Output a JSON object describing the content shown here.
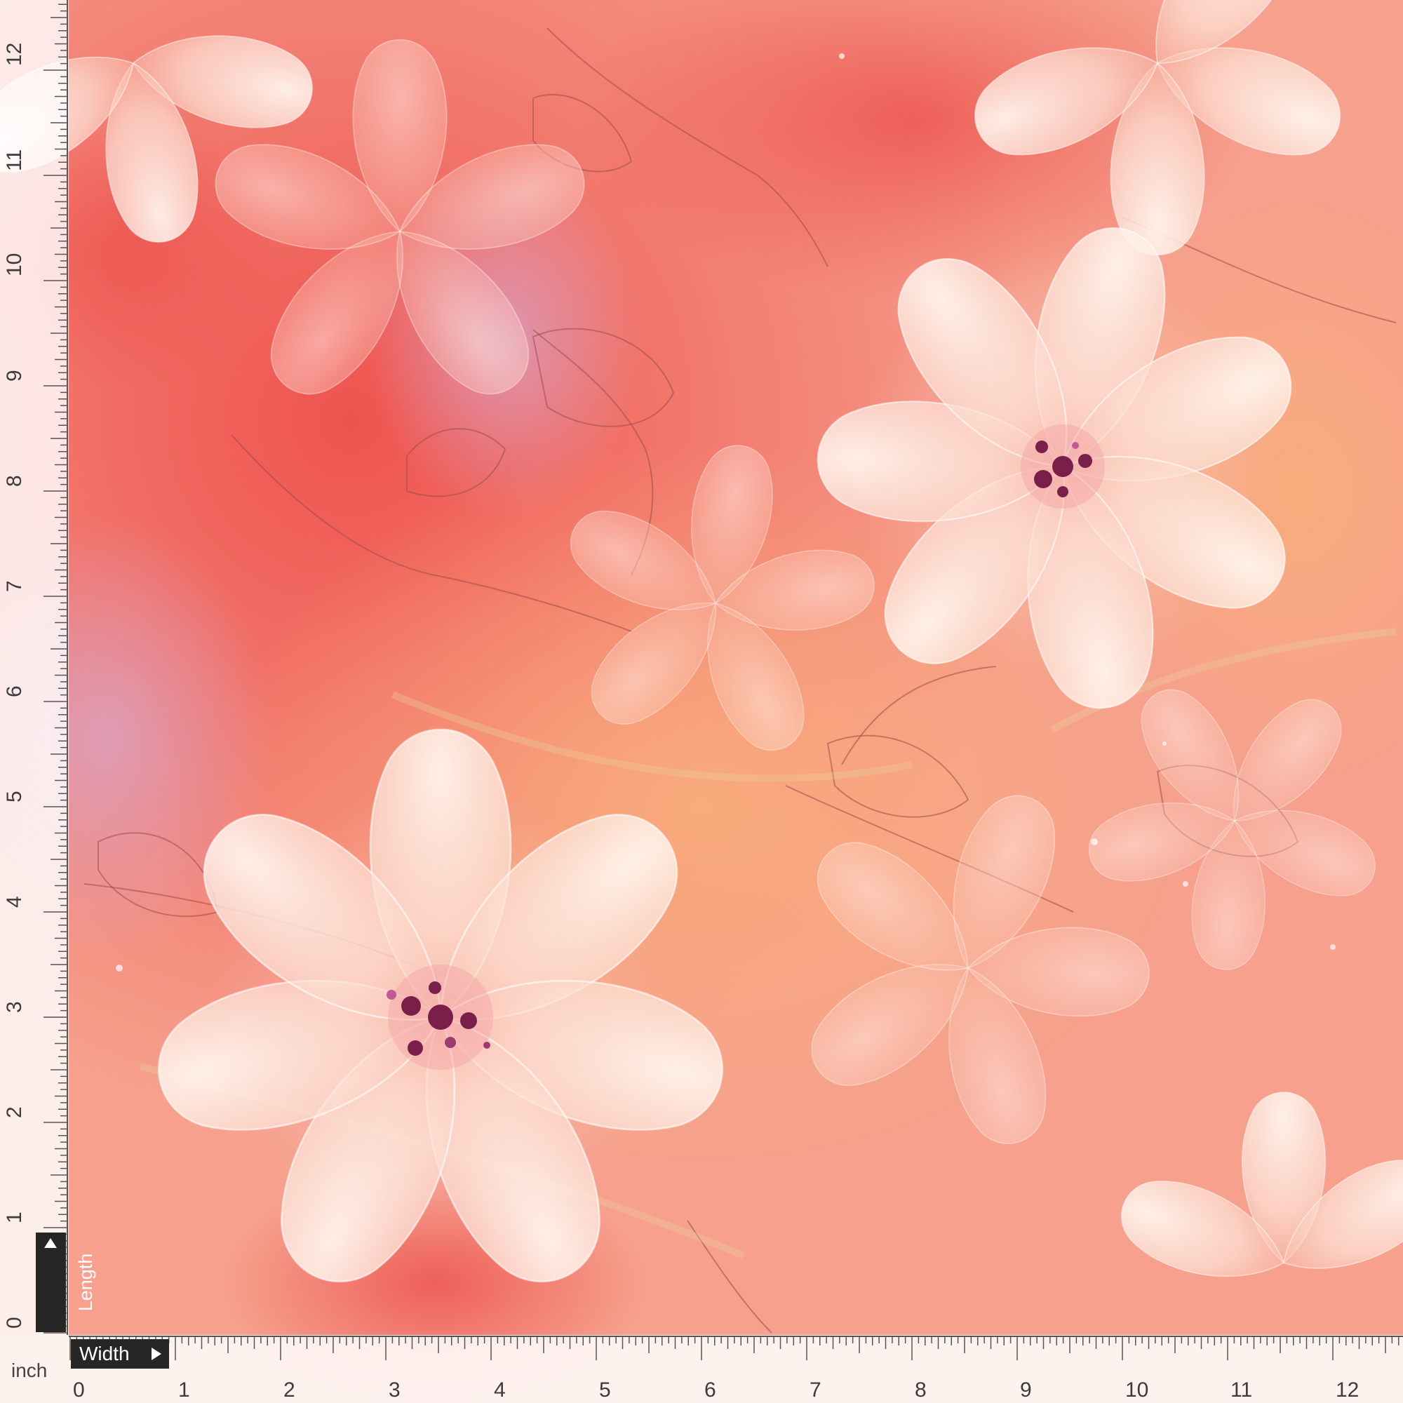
{
  "colors": {
    "base": "#f7a08a",
    "coral": "#ef5e53",
    "peach": "#f9b38f",
    "petal": "#fff5ef",
    "center": "#7a1f4a",
    "sketch": "#9a4c4a",
    "ruler_bg": "#ffffff",
    "tag_bg": "#262626"
  },
  "ruler": {
    "unit": "inch",
    "length_label": "Length",
    "width_label": "Width",
    "length_ticks": [
      "0",
      "1",
      "2",
      "3",
      "4",
      "5",
      "6",
      "7",
      "8",
      "9",
      "10",
      "11",
      "12"
    ],
    "width_ticks": [
      "0",
      "1",
      "2",
      "3",
      "4",
      "5",
      "6",
      "7",
      "8",
      "9",
      "10",
      "11",
      "12"
    ]
  }
}
